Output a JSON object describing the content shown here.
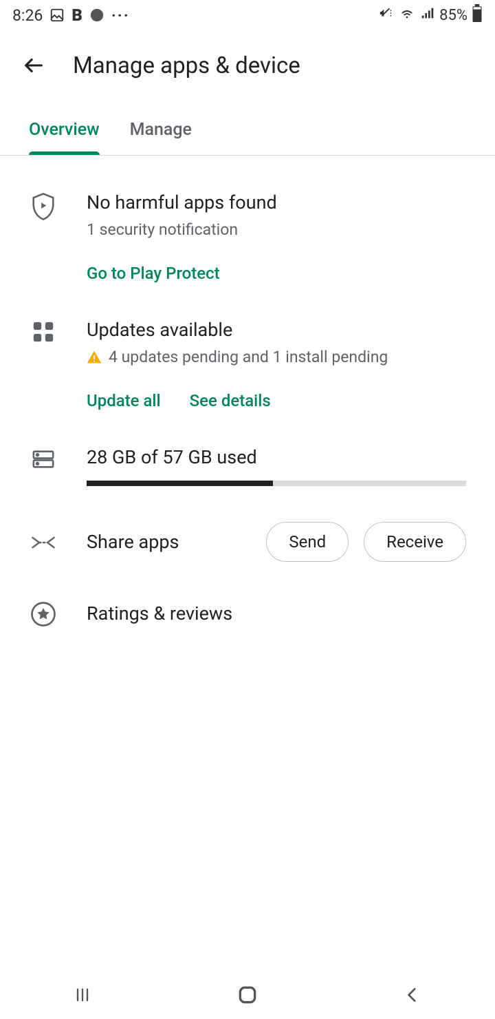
{
  "status_bar": {
    "time": "8:26",
    "battery_pct": "85%"
  },
  "app_bar": {
    "title": "Manage apps & device"
  },
  "tabs": {
    "overview": "Overview",
    "manage": "Manage"
  },
  "protect": {
    "title": "No harmful apps found",
    "sub": "1 security notification",
    "action": "Go to Play Protect"
  },
  "updates": {
    "title": "Updates available",
    "sub": "4 updates pending and 1 install pending",
    "update_all": "Update all",
    "see_details": "See details"
  },
  "storage": {
    "label": "28 GB of 57 GB used",
    "used": 28,
    "total": 57
  },
  "share": {
    "title": "Share apps",
    "send": "Send",
    "receive": "Receive"
  },
  "ratings": {
    "title": "Ratings & reviews"
  },
  "colors": {
    "accent": "#00875f",
    "warning": "#f9ab00"
  }
}
